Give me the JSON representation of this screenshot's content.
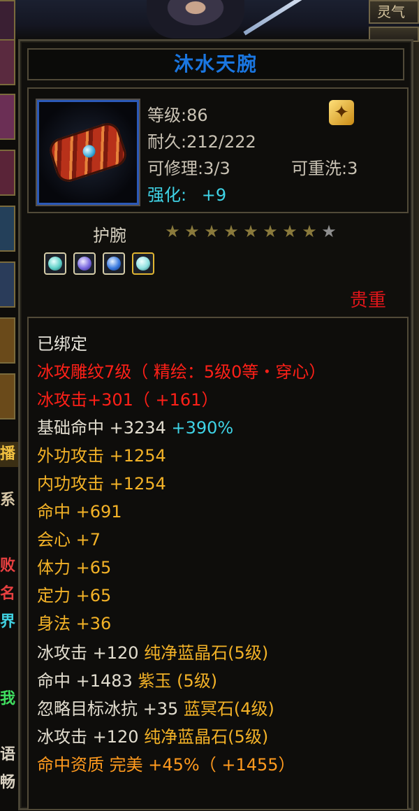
{
  "top_tabs": {
    "primary": "灵气"
  },
  "left_strip_chars": [
    "播",
    "系",
    "败",
    "名",
    "界",
    "我",
    "语",
    "畅"
  ],
  "item": {
    "name": "沐水天腕",
    "name_color": "#1a76e0",
    "level": "等级:86",
    "durability": "耐久:212/222",
    "repairable": "可修理:3/3",
    "rewashable": "可重洗:3",
    "enhance_label": "强化:",
    "enhance_value": "+9",
    "type": "护腕",
    "stars": {
      "filled": 8,
      "total": 9
    },
    "gems": [
      {
        "icon": "cyan-gem-icon",
        "color": "#5fd0c8"
      },
      {
        "icon": "purple-gem-icon",
        "color": "#7a6ae0"
      },
      {
        "icon": "blue-gem-icon",
        "color": "#3b7be0"
      },
      {
        "icon": "cyan-gem-icon",
        "color": "#8fe0e0"
      }
    ],
    "rarity": "贵重"
  },
  "attributes": [
    {
      "text": "已绑定",
      "color": "white"
    },
    {
      "text": "冰攻雕纹7级（ 精绘：5级0等・穿心）",
      "color": "red"
    },
    {
      "text": "冰攻击+301（ +161）",
      "color": "red"
    },
    {
      "text": "基础命中 +3234 ",
      "extra": "+390%",
      "color": "gold-mixed"
    },
    {
      "text": "外功攻击 +1254",
      "color": "gold"
    },
    {
      "text": "内功攻击 +1254",
      "color": "gold"
    },
    {
      "text": "命中 +691",
      "color": "gold"
    },
    {
      "text": "会心 +7",
      "color": "gold"
    },
    {
      "text": "体力 +65",
      "color": "gold"
    },
    {
      "text": "定力 +65",
      "color": "gold"
    },
    {
      "text": "身法 +36",
      "color": "gold"
    },
    {
      "text": "冰攻击 +120 ",
      "extra": "纯净蓝晶石(5级)",
      "color": "white-gold"
    },
    {
      "text": "命中 +1483 ",
      "extra": "紫玉 (5级)",
      "color": "white-gold"
    },
    {
      "text": "忽略目标冰抗 +35 ",
      "extra": "蓝冥石(4级)",
      "color": "white-gold"
    },
    {
      "text": "冰攻击 +120 ",
      "extra": "纯净蓝晶石(5级)",
      "color": "white-gold"
    },
    {
      "text": "命中资质 完美 +45%（ +1455）",
      "color": "orange"
    }
  ]
}
